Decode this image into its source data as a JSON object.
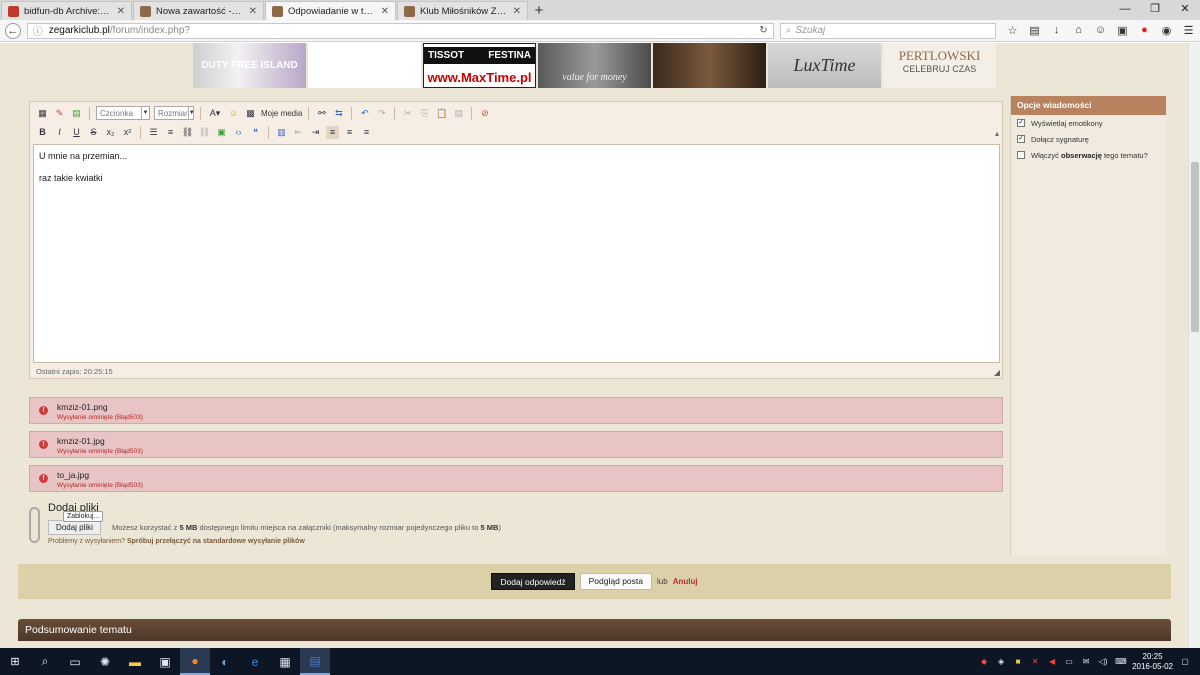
{
  "browser": {
    "tabs": [
      {
        "title": "bidfun-db Archive: Watch...",
        "active": false,
        "fav_color": "#c0392b"
      },
      {
        "title": "Nowa zawartość - Klub Mi...",
        "active": false,
        "fav_color": "#8b6a48"
      },
      {
        "title": "Odpowiadanie w temacie:...",
        "active": true,
        "fav_color": "#8b6a48"
      },
      {
        "title": "Klub Miłośników Zegarów...",
        "active": false,
        "fav_color": "#8b6a48"
      }
    ],
    "url_domain": "zegarkiclub.pl",
    "url_path": "/forum/index.php?",
    "search_placeholder": "Szukaj"
  },
  "banners": {
    "b1_text": "DUTY FREE ISLAND",
    "b3_brand1": "TISSOT",
    "b3_brand2": "FESTINA",
    "b3_site": "www.MaxTime.pl",
    "b4_text": "value for money",
    "b6_text": "LuxTime",
    "b7_big": "PERTLOWSKI",
    "b7_small": "CELEBRUJ CZAS"
  },
  "editor": {
    "font_select": "Czcionka",
    "size_select": "Rozmiar",
    "media_label": "Moje media",
    "content_line1": "U mnie na przemian...",
    "content_line2": "raz takie kwiatki",
    "last_saved": "Ostatni zapis: 20:25:15"
  },
  "uploads": [
    {
      "filename": "kmziz-01.png",
      "error": "Wysyłanie ominięte (Błąd503)"
    },
    {
      "filename": "kmziz-01.jpg",
      "error": "Wysyłanie ominięte (Błąd503)"
    },
    {
      "filename": "to_ja.jpg",
      "error": "Wysyłanie ominięte (Błąd503)"
    }
  ],
  "attach": {
    "title": "Dodaj pliki",
    "button": "Dodaj pliki",
    "tooltip": "Zablokuj...",
    "info_prefix": "Możesz korzystać z",
    "info_limit": "5 MB",
    "info_middle": "dostępnego limitu miejsca na załączniki (maksymalny rozmiar pojedynczego pliku to",
    "info_max": "5 MB",
    "info_suffix": ")",
    "problem_text": "Problemy z wysyłaniem?",
    "problem_link": "Spróbuj przełączyć na standardowe wysyłanie plików"
  },
  "options": {
    "title": "Opcje wiadomości",
    "items": [
      {
        "label": "Wyświetlaj emotikony",
        "checked": true
      },
      {
        "label": "Dołącz sygnaturę",
        "checked": true
      },
      {
        "label_before": "Włączyć",
        "label_bold": "obserwację",
        "label_after": "tego tematu?",
        "checked": false
      }
    ]
  },
  "submit": {
    "reply": "Dodaj odpowiedź",
    "preview": "Podgląd posta",
    "or": "lub",
    "cancel": "Anuluj"
  },
  "summary_title": "Podsumowanie tematu",
  "taskbar": {
    "time": "20:25",
    "date": "2016-05-02"
  }
}
